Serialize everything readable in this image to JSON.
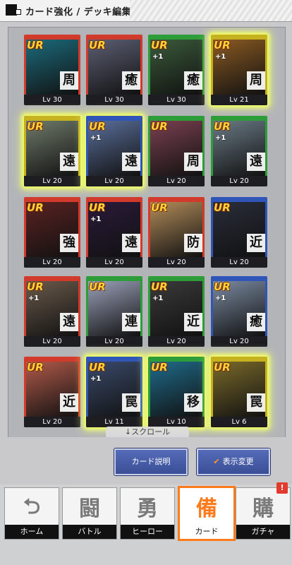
{
  "header": {
    "title": "カード強化 / デッキ編集"
  },
  "cards": [
    {
      "rarity": "UR",
      "plus": "",
      "type": "周",
      "level": "Lv 30",
      "frame": "#d23b2b",
      "art": "#1b6b7c",
      "glow": false
    },
    {
      "rarity": "UR",
      "plus": "",
      "type": "癒",
      "level": "Lv 30",
      "frame": "#d23b2b",
      "art": "#5c5f73",
      "glow": false
    },
    {
      "rarity": "UR",
      "plus": "+1",
      "type": "癒",
      "level": "Lv 30",
      "frame": "#2d9d3a",
      "art": "#3a5a3a",
      "glow": false
    },
    {
      "rarity": "UR",
      "plus": "+1",
      "type": "周",
      "level": "Lv 21",
      "frame": "#c6b21e",
      "art": "#8a5a22",
      "glow": true
    },
    {
      "rarity": "UR",
      "plus": "",
      "type": "遠",
      "level": "Lv 20",
      "frame": "#c6b21e",
      "art": "#6f7a6a",
      "glow": true
    },
    {
      "rarity": "UR",
      "plus": "+1",
      "type": "遠",
      "level": "Lv 20",
      "frame": "#2f55b8",
      "art": "#5a6f9a",
      "glow": true
    },
    {
      "rarity": "UR",
      "plus": "",
      "type": "周",
      "level": "Lv 20",
      "frame": "#2d9d3a",
      "art": "#7a4050",
      "glow": false
    },
    {
      "rarity": "UR",
      "plus": "+1",
      "type": "遠",
      "level": "Lv 20",
      "frame": "#2d9d3a",
      "art": "#6a7a85",
      "glow": false
    },
    {
      "rarity": "UR",
      "plus": "",
      "type": "強",
      "level": "Lv 20",
      "frame": "#d23b2b",
      "art": "#5a2222",
      "glow": false
    },
    {
      "rarity": "UR",
      "plus": "+1",
      "type": "遠",
      "level": "Lv 20",
      "frame": "#d23b2b",
      "art": "#2a1a3a",
      "glow": false
    },
    {
      "rarity": "UR",
      "plus": "",
      "type": "防",
      "level": "Lv 20",
      "frame": "#d23b2b",
      "art": "#b28c5a",
      "glow": false
    },
    {
      "rarity": "UR",
      "plus": "",
      "type": "近",
      "level": "Lv 20",
      "frame": "#2f55b8",
      "art": "#2a2d3a",
      "glow": false
    },
    {
      "rarity": "UR",
      "plus": "+1",
      "type": "遠",
      "level": "Lv 20",
      "frame": "#d23b2b",
      "art": "#6a5a4a",
      "glow": false
    },
    {
      "rarity": "UR",
      "plus": "",
      "type": "連",
      "level": "Lv 20",
      "frame": "#2d9d3a",
      "art": "#9aa0b8",
      "glow": false
    },
    {
      "rarity": "UR",
      "plus": "+1",
      "type": "近",
      "level": "Lv 20",
      "frame": "#2d9d3a",
      "art": "#3a3a3a",
      "glow": false
    },
    {
      "rarity": "UR",
      "plus": "+1",
      "type": "癒",
      "level": "Lv 20",
      "frame": "#2f55b8",
      "art": "#7a8aa0",
      "glow": false
    },
    {
      "rarity": "UR",
      "plus": "",
      "type": "近",
      "level": "Lv 20",
      "frame": "#d23b2b",
      "art": "#b05a4a",
      "glow": false
    },
    {
      "rarity": "UR",
      "plus": "+1",
      "type": "罠",
      "level": "Lv 11",
      "frame": "#2f55b8",
      "art": "#3a4a6a",
      "glow": true
    },
    {
      "rarity": "UR",
      "plus": "",
      "type": "移",
      "level": "Lv 10",
      "frame": "#2d9d3a",
      "art": "#1f6b8a",
      "glow": true
    },
    {
      "rarity": "UR",
      "plus": "",
      "type": "罠",
      "level": "Lv 6",
      "frame": "#c6b21e",
      "art": "#7a6a2a",
      "glow": true
    }
  ],
  "scroll_hint": "↓スクロール",
  "actions": {
    "card_description": "カード説明",
    "display_change": "表示変更",
    "check_icon": "✔"
  },
  "nav": {
    "tabs": [
      {
        "label": "ホーム",
        "glyph": "⮌"
      },
      {
        "label": "バトル",
        "glyph": "闘"
      },
      {
        "label": "ヒーロー",
        "glyph": "勇"
      },
      {
        "label": "カード",
        "glyph": "備"
      },
      {
        "label": "ガチャ",
        "glyph": "購"
      }
    ],
    "gacha_badge": "!"
  }
}
